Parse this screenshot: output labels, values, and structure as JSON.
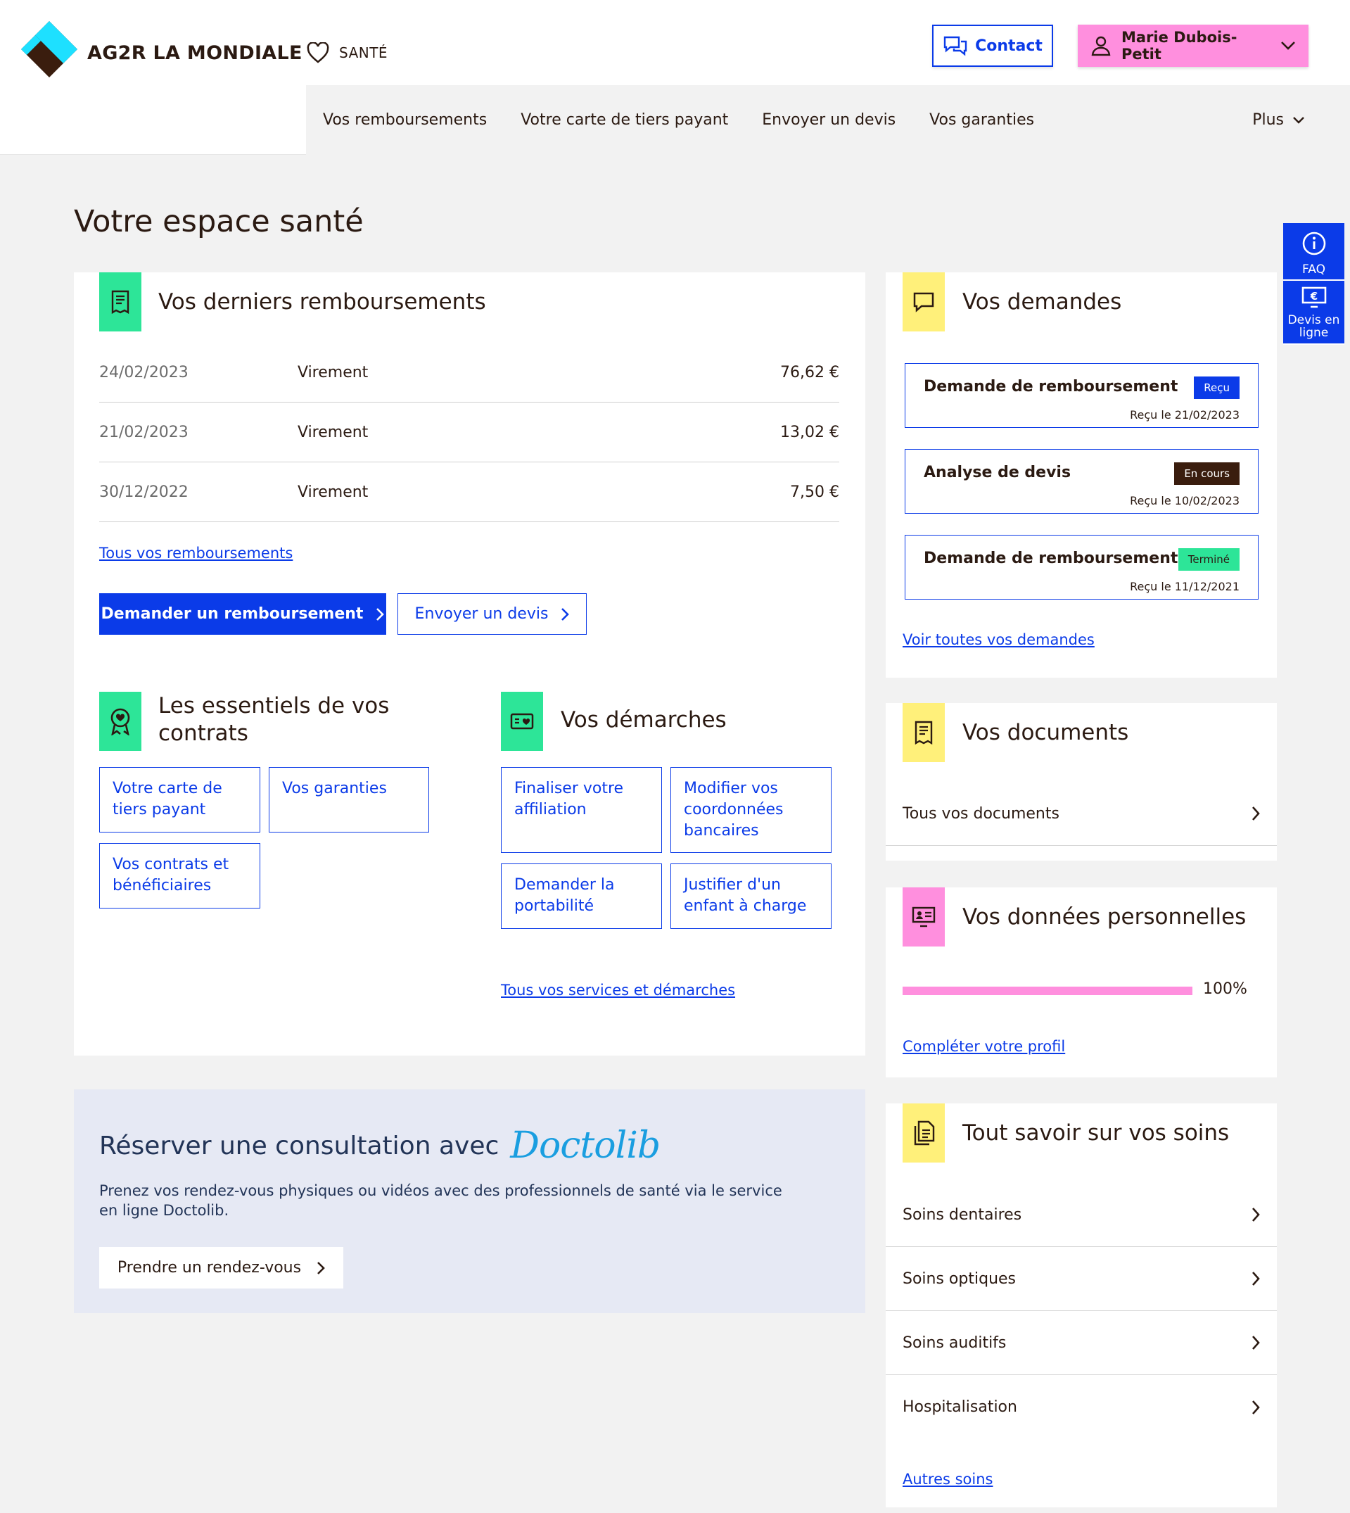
{
  "header": {
    "brand": "AG2R LA MONDIALE",
    "universe": "SANTÉ",
    "contact_label": "Contact",
    "user_name": "Marie Dubois-Petit",
    "nav": [
      "Vos remboursements",
      "Votre carte de tiers payant",
      "Envoyer un devis",
      "Vos garanties"
    ],
    "nav_more": "Plus"
  },
  "page_title": "Votre espace santé",
  "side_tools": {
    "faq": "FAQ",
    "devis": "Devis en ligne"
  },
  "reimbursements": {
    "title": "Vos derniers remboursements",
    "rows": [
      {
        "date": "24/02/2023",
        "type": "Virement",
        "amount": "76,62 €"
      },
      {
        "date": "21/02/2023",
        "type": "Virement",
        "amount": "13,02 €"
      },
      {
        "date": "30/12/2022",
        "type": "Virement",
        "amount": "7,50 €"
      }
    ],
    "all_link": "Tous vos remboursements",
    "primary_btn": "Demander un remboursement",
    "secondary_btn": "Envoyer un devis"
  },
  "essentials": {
    "title_l1": "Les essentiels de vos",
    "title_l2": "contrats",
    "tiles": [
      "Votre carte de tiers payant",
      "Vos garanties",
      "Vos contrats et bénéficiaires"
    ]
  },
  "demarches": {
    "title": "Vos démarches",
    "tiles": [
      "Finaliser votre affiliation",
      "Modifier vos coordonnées bancaires",
      "Demander la portabilité",
      "Justifier d'un enfant à charge"
    ],
    "all_link": "Tous vos services et démarches"
  },
  "demandes": {
    "title": "Vos demandes",
    "items": [
      {
        "title": "Demande de remboursement",
        "status": "Reçu",
        "date": "Reçu le 21/02/2023",
        "status_color": "#0b3be8"
      },
      {
        "title": "Analyse de devis",
        "status": "En cours",
        "date": "Reçu le 10/02/2023",
        "status_color": "#3a1d0e"
      },
      {
        "title": "Demande de remboursement",
        "status": "Terminé",
        "date": "Reçu le 11/12/2021",
        "status_color": "#2de598"
      }
    ],
    "all_link": "Voir toutes vos demandes"
  },
  "documents": {
    "title": "Vos documents",
    "row": "Tous vos documents"
  },
  "personal": {
    "title": "Vos données personnelles",
    "progress": 100,
    "progress_label": "100%",
    "link": "Compléter votre profil"
  },
  "soins": {
    "title": "Tout savoir sur vos soins",
    "rows": [
      "Soins dentaires",
      "Soins optiques",
      "Soins auditifs",
      "Hospitalisation"
    ],
    "link": "Autres soins"
  },
  "doctolib": {
    "title": "Réserver une consultation avec",
    "logo_text": "Doctolib",
    "desc_l1": "Prenez vos rendez-vous physiques ou vidéos avec des professionnels de santé via le service",
    "desc_l2": "en ligne Doctolib.",
    "btn": "Prendre un rendez-vous"
  },
  "colors": {
    "primary": "#0b3be8",
    "green": "#2de598",
    "yellow": "#fff07a",
    "pink": "#ff8fde",
    "text": "#2b1a12"
  }
}
